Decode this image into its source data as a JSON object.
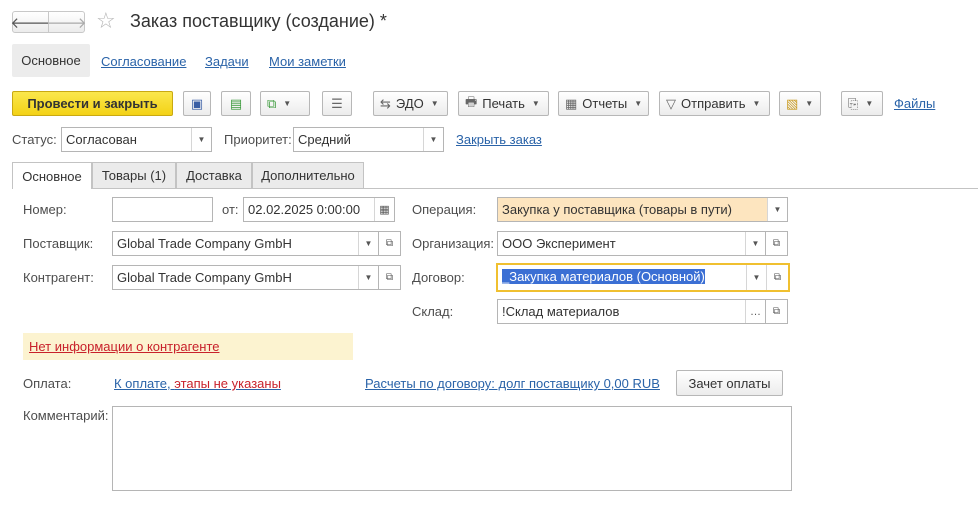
{
  "window": {
    "title": "Заказ поставщику (создание) *"
  },
  "nav": {
    "sections": [
      "Основное",
      "Согласование",
      "Задачи",
      "Мои заметки"
    ]
  },
  "toolbar": {
    "post_close": "Провести и закрыть",
    "edo": "ЭДО",
    "print": "Печать",
    "reports": "Отчеты",
    "send": "Отправить",
    "files": "Файлы"
  },
  "header": {
    "status_label": "Статус:",
    "status_value": "Согласован",
    "priority_label": "Приоритет:",
    "priority_value": "Средний",
    "close_order": "Закрыть заказ"
  },
  "tabs": [
    "Основное",
    "Товары (1)",
    "Доставка",
    "Дополнительно"
  ],
  "form": {
    "number_label": "Номер:",
    "number_value": "",
    "from_label": "от:",
    "date_value": "02.02.2025  0:00:00",
    "supplier_label": "Поставщик:",
    "supplier_value": "Global Trade Company GmbH",
    "counterparty_label": "Контрагент:",
    "counterparty_value": "Global Trade Company GmbH",
    "operation_label": "Операция:",
    "operation_value": "Закупка у поставщика (товары в пути)",
    "organization_label": "Организация:",
    "organization_value": "ООО Эксперимент",
    "contract_label": "Договор:",
    "contract_value": "_Закупка материалов (Основной)",
    "warehouse_label": "Склад:",
    "warehouse_value": "!Склад материалов",
    "warning_link": "Нет информации о контрагенте",
    "payment_label": "Оплата:",
    "payment_link": "К оплате, этапы не указаны",
    "settlements_link": "Расчеты по договору: долг поставщику 0,00 RUB",
    "payment_offset_button": "Зачет оплаты",
    "comment_label": "Комментарий:",
    "comment_value": ""
  },
  "colors": {
    "accent_yellow": "#f3d216",
    "link_blue": "#2a63a8",
    "link_red": "#c8212b",
    "operation_bg": "#fde5bf",
    "warning_bg": "#fcf3d0",
    "focus_border": "#f0c030"
  },
  "icons": [
    "back-arrow-icon",
    "forward-arrow-icon",
    "star-icon",
    "save-icon",
    "post-icon",
    "create-based-icon",
    "list-icon",
    "edo-icon",
    "printer-icon",
    "reports-icon",
    "send-icon",
    "attach-icon",
    "calendar-icon",
    "open-icon",
    "dropdown-icon"
  ]
}
